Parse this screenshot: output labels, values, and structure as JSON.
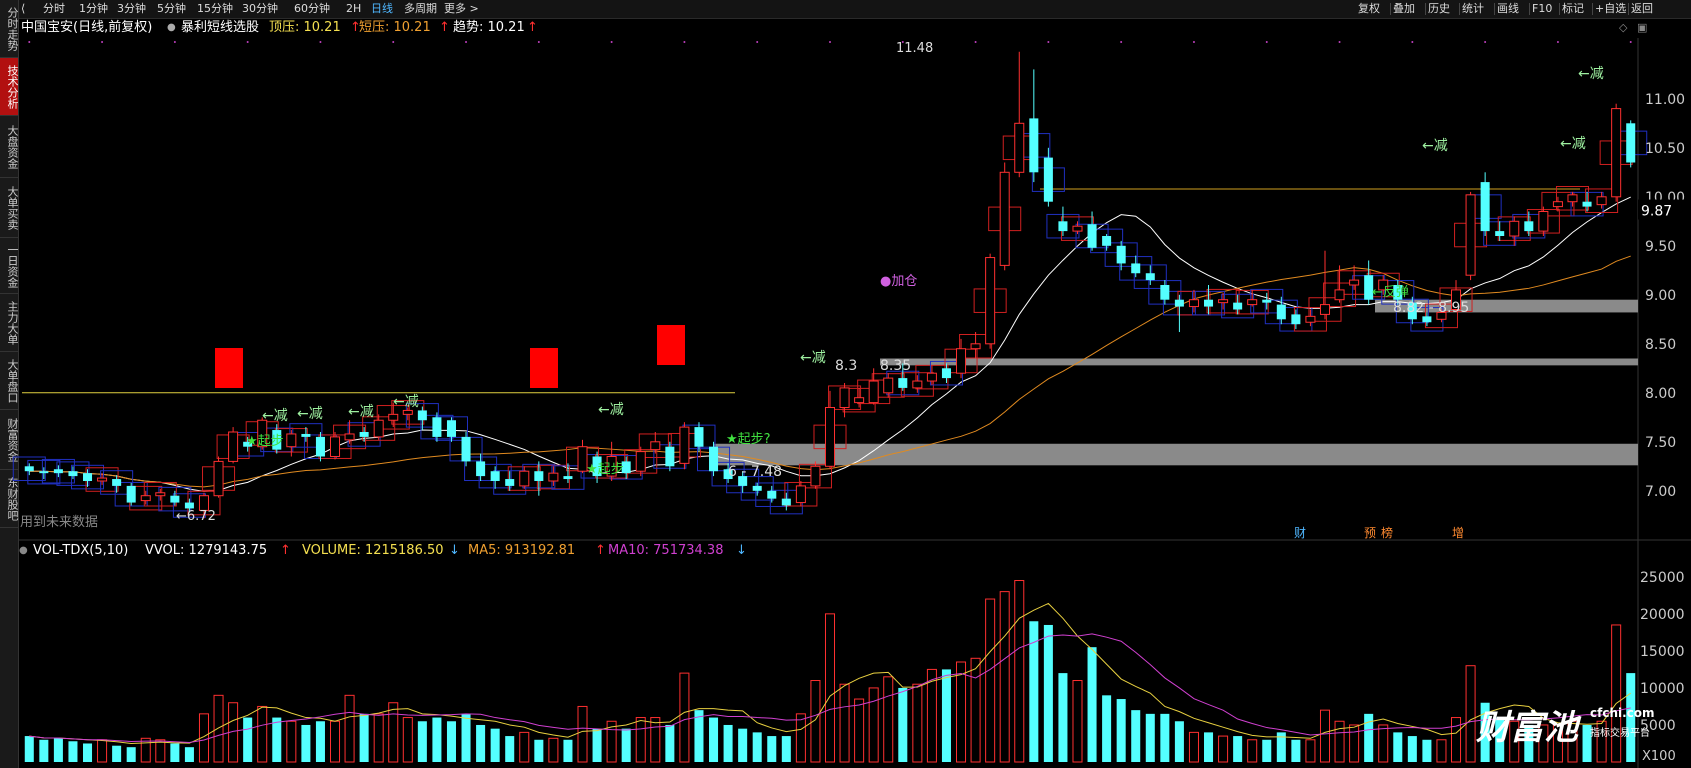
{
  "sidebar": {
    "tabs": [
      {
        "label": "分时走势",
        "active": false
      },
      {
        "label": "技术分析",
        "active": true
      },
      {
        "label": "大盘资金",
        "active": false
      },
      {
        "label": "大单买卖",
        "active": false
      },
      {
        "label": "一日资金",
        "active": false
      },
      {
        "label": "主力大单",
        "active": false
      },
      {
        "label": "大单盘口",
        "active": false
      },
      {
        "label": "财富资金",
        "active": false
      },
      {
        "label": "东财股吧",
        "active": false
      }
    ]
  },
  "toolbar": {
    "back_icon": "back-arrow-icon",
    "periods": [
      {
        "label": "分时",
        "active": false
      },
      {
        "label": "1分钟",
        "active": false
      },
      {
        "label": "3分钟",
        "active": false
      },
      {
        "label": "5分钟",
        "active": false
      },
      {
        "label": "15分钟",
        "active": false
      },
      {
        "label": "30分钟",
        "active": false
      },
      {
        "label": "60分钟",
        "active": false
      },
      {
        "label": "2H",
        "active": false
      },
      {
        "label": "日线",
        "active": true
      },
      {
        "label": "多周期",
        "active": false
      },
      {
        "label": "更多 >",
        "active": false
      }
    ],
    "right": [
      "复权",
      "叠加",
      "历史",
      "统计",
      "画线",
      "F10",
      "标记",
      "+自选",
      "返回"
    ]
  },
  "info": {
    "stock": "中国宝安(日线,前复权)",
    "indicator": "暴利短线选股",
    "top_label": "顶压: 10.21",
    "short_label": "短压: 10.21",
    "trend_label": "趋势: 10.21",
    "arrow": "↑",
    "colors": {
      "top": "#f5e050",
      "short": "#f0a030",
      "trend": "#ffffff",
      "arrow": "#ff3030"
    }
  },
  "price_axis": {
    "labels": [
      "11.00",
      "10.50",
      "10.00",
      "9.50",
      "9.00",
      "8.50",
      "8.00",
      "7.50",
      "7.00"
    ],
    "current": "9.87"
  },
  "annotations": {
    "high": "11.48",
    "low": "6.72",
    "zone1": "6 - 7.48",
    "zone2": "8.35",
    "zone2_prefix": "8.3",
    "zone3": "8.82 - 8.95",
    "future_note": "用到未来数据",
    "reduce": "←减",
    "start": "★起步",
    "start2": "★起步?",
    "add": "●加仓",
    "rebound": "←反弹",
    "markers": [
      "财",
      "预",
      "榜",
      "增"
    ]
  },
  "volume": {
    "indicator": "VOL-TDX(5,10)",
    "vvol": "VVOL: 1279143.75",
    "vol": "VOLUME: 1215186.50",
    "ma5": "MA5: 913192.81",
    "ma10": "MA10: 751734.38",
    "up_arrow": "↑",
    "down_arrow": "↓",
    "axis": [
      "25000",
      "20000",
      "15000",
      "10000",
      "5000"
    ],
    "unit": "X100",
    "colors": {
      "vvol": "#ffffff",
      "vol": "#f5e050",
      "ma5": "#f0a030",
      "ma10": "#d040d0"
    }
  },
  "watermark": {
    "brand": "财富池",
    "domain": "cfchi.com",
    "slogan": "指标交易平台"
  },
  "chart_data": {
    "type": "candlestick",
    "title": "中国宝安(日线,前复权)",
    "y_range": [
      6.6,
      11.6
    ],
    "candles": [
      [
        7.25,
        7.2,
        7.28,
        7.16,
        0
      ],
      [
        7.18,
        7.2,
        7.24,
        7.12,
        0
      ],
      [
        7.22,
        7.18,
        7.26,
        7.14,
        0
      ],
      [
        7.15,
        7.2,
        7.25,
        7.12,
        0
      ],
      [
        7.18,
        7.1,
        7.22,
        7.04,
        0
      ],
      [
        7.1,
        7.13,
        7.18,
        7.06,
        1
      ],
      [
        7.12,
        7.05,
        7.16,
        6.98,
        0
      ],
      [
        7.05,
        6.88,
        7.08,
        6.85,
        0
      ],
      [
        6.9,
        6.95,
        7.0,
        6.86,
        1
      ],
      [
        6.95,
        6.98,
        7.02,
        6.9,
        1
      ],
      [
        6.95,
        6.88,
        7.0,
        6.85,
        0
      ],
      [
        6.88,
        6.82,
        6.92,
        6.78,
        0
      ],
      [
        6.8,
        6.95,
        6.98,
        6.72,
        1
      ],
      [
        6.95,
        7.3,
        7.35,
        6.93,
        1
      ],
      [
        7.3,
        7.6,
        7.65,
        7.28,
        1
      ],
      [
        7.5,
        7.45,
        7.55,
        7.4,
        0
      ],
      [
        7.45,
        7.72,
        7.75,
        7.42,
        1
      ],
      [
        7.62,
        7.42,
        7.68,
        7.38,
        0
      ],
      [
        7.45,
        7.58,
        7.62,
        7.35,
        1
      ],
      [
        7.58,
        7.55,
        7.65,
        7.5,
        0
      ],
      [
        7.55,
        7.35,
        7.6,
        7.3,
        0
      ],
      [
        7.35,
        7.55,
        7.6,
        7.32,
        1
      ],
      [
        7.52,
        7.58,
        7.72,
        7.48,
        1
      ],
      [
        7.6,
        7.55,
        7.65,
        7.5,
        0
      ],
      [
        7.55,
        7.72,
        7.78,
        7.52,
        1
      ],
      [
        7.72,
        7.78,
        7.9,
        7.65,
        1
      ],
      [
        7.78,
        7.82,
        7.85,
        7.72,
        1
      ],
      [
        7.82,
        7.72,
        7.86,
        7.62,
        0
      ],
      [
        7.75,
        7.55,
        7.8,
        7.5,
        0
      ],
      [
        7.72,
        7.55,
        7.75,
        7.5,
        0
      ],
      [
        7.55,
        7.3,
        7.6,
        7.25,
        0
      ],
      [
        7.3,
        7.15,
        7.38,
        7.1,
        0
      ],
      [
        7.2,
        7.1,
        7.25,
        7.02,
        0
      ],
      [
        7.12,
        7.05,
        7.2,
        7.0,
        0
      ],
      [
        7.05,
        7.2,
        7.25,
        7.02,
        1
      ],
      [
        7.2,
        7.1,
        7.3,
        6.95,
        0
      ],
      [
        7.1,
        7.18,
        7.25,
        7.05,
        1
      ],
      [
        7.15,
        7.12,
        7.28,
        7.08,
        0
      ],
      [
        7.2,
        7.45,
        7.52,
        7.18,
        1
      ],
      [
        7.35,
        7.15,
        7.4,
        7.08,
        0
      ],
      [
        7.15,
        7.35,
        7.5,
        7.1,
        1
      ],
      [
        7.3,
        7.18,
        7.35,
        7.12,
        0
      ],
      [
        7.2,
        7.4,
        7.45,
        7.15,
        1
      ],
      [
        7.42,
        7.5,
        7.6,
        7.38,
        1
      ],
      [
        7.45,
        7.25,
        7.5,
        7.2,
        0
      ],
      [
        7.28,
        7.65,
        7.7,
        7.22,
        1
      ],
      [
        7.65,
        7.45,
        7.7,
        7.4,
        0
      ],
      [
        7.45,
        7.2,
        7.5,
        7.15,
        0
      ],
      [
        7.22,
        7.12,
        7.28,
        7.08,
        0
      ],
      [
        7.15,
        7.05,
        7.2,
        6.98,
        0
      ],
      [
        7.05,
        7.0,
        7.08,
        6.95,
        0
      ],
      [
        7.0,
        6.92,
        7.05,
        6.88,
        0
      ],
      [
        6.92,
        6.85,
        6.98,
        6.8,
        0
      ],
      [
        6.88,
        7.05,
        7.1,
        6.84,
        1
      ],
      [
        7.05,
        7.25,
        7.3,
        7.02,
        1
      ],
      [
        7.25,
        7.85,
        8.02,
        7.22,
        1
      ],
      [
        7.85,
        8.05,
        8.1,
        7.75,
        1
      ],
      [
        7.9,
        7.95,
        8.05,
        7.85,
        1
      ],
      [
        7.9,
        8.12,
        8.25,
        7.88,
        1
      ],
      [
        8.0,
        8.15,
        8.2,
        7.95,
        1
      ],
      [
        8.15,
        8.05,
        8.3,
        8.02,
        0
      ],
      [
        8.05,
        8.12,
        8.18,
        8.0,
        1
      ],
      [
        8.12,
        8.2,
        8.28,
        8.08,
        1
      ],
      [
        8.25,
        8.15,
        8.3,
        8.1,
        0
      ],
      [
        8.2,
        8.45,
        8.55,
        8.15,
        1
      ],
      [
        8.45,
        8.5,
        8.62,
        8.35,
        1
      ],
      [
        8.5,
        9.38,
        9.42,
        8.45,
        1
      ],
      [
        9.3,
        10.25,
        10.35,
        9.25,
        1
      ],
      [
        10.25,
        10.75,
        11.48,
        10.2,
        1
      ],
      [
        10.8,
        10.25,
        11.3,
        10.15,
        0
      ],
      [
        10.4,
        9.95,
        10.5,
        9.9,
        0
      ],
      [
        9.75,
        9.65,
        9.9,
        9.6,
        0
      ],
      [
        9.7,
        9.65,
        9.75,
        9.62,
        1
      ],
      [
        9.72,
        9.48,
        9.85,
        9.45,
        0
      ],
      [
        9.6,
        9.5,
        9.62,
        9.45,
        0
      ],
      [
        9.5,
        9.32,
        9.55,
        9.25,
        0
      ],
      [
        9.32,
        9.22,
        9.4,
        9.18,
        0
      ],
      [
        9.22,
        9.15,
        9.3,
        9.1,
        0
      ],
      [
        9.1,
        8.95,
        9.15,
        8.9,
        0
      ],
      [
        8.95,
        8.88,
        9.0,
        8.62,
        0
      ],
      [
        8.88,
        8.95,
        9.05,
        8.82,
        1
      ],
      [
        8.95,
        8.88,
        9.1,
        8.8,
        0
      ],
      [
        8.92,
        8.95,
        9.02,
        8.85,
        1
      ],
      [
        8.92,
        8.85,
        9.0,
        8.8,
        0
      ],
      [
        8.9,
        8.95,
        9.05,
        8.88,
        1
      ],
      [
        8.95,
        8.92,
        9.02,
        8.85,
        0
      ],
      [
        8.9,
        8.75,
        8.98,
        8.7,
        0
      ],
      [
        8.8,
        8.7,
        8.85,
        8.65,
        0
      ],
      [
        8.72,
        8.78,
        8.85,
        8.68,
        1
      ],
      [
        8.8,
        8.9,
        9.45,
        8.75,
        1
      ],
      [
        8.95,
        9.05,
        9.3,
        8.92,
        1
      ],
      [
        9.1,
        9.15,
        9.3,
        9.05,
        1
      ],
      [
        9.2,
        8.95,
        9.35,
        8.9,
        0
      ],
      [
        9.05,
        9.15,
        9.2,
        9.0,
        1
      ],
      [
        9.1,
        8.95,
        9.15,
        8.9,
        0
      ],
      [
        8.92,
        8.75,
        8.98,
        8.7,
        0
      ],
      [
        8.78,
        8.72,
        8.82,
        8.68,
        0
      ],
      [
        8.75,
        8.82,
        8.85,
        8.72,
        1
      ],
      [
        8.85,
        9.05,
        9.15,
        8.82,
        1
      ],
      [
        9.2,
        10.02,
        10.05,
        9.15,
        1
      ],
      [
        10.15,
        9.65,
        10.25,
        9.6,
        0
      ],
      [
        9.65,
        9.6,
        9.75,
        9.55,
        0
      ],
      [
        9.6,
        9.75,
        9.8,
        9.5,
        1
      ],
      [
        9.75,
        9.65,
        9.85,
        9.6,
        0
      ],
      [
        9.65,
        9.85,
        9.9,
        9.6,
        1
      ],
      [
        9.9,
        9.95,
        10.0,
        9.85,
        1
      ],
      [
        9.95,
        10.02,
        10.05,
        9.9,
        1
      ],
      [
        9.95,
        9.9,
        10.05,
        9.85,
        0
      ],
      [
        9.92,
        10.0,
        10.05,
        9.88,
        1
      ],
      [
        10.0,
        10.9,
        10.95,
        9.95,
        1
      ],
      [
        10.75,
        10.35,
        10.78,
        10.3,
        0
      ]
    ],
    "volumes": [
      [
        3.5,
        0
      ],
      [
        3.0,
        0
      ],
      [
        3.2,
        0
      ],
      [
        2.8,
        0
      ],
      [
        2.5,
        0
      ],
      [
        3.0,
        1
      ],
      [
        2.2,
        0
      ],
      [
        2.0,
        0
      ],
      [
        3.2,
        1
      ],
      [
        3.0,
        1
      ],
      [
        2.5,
        0
      ],
      [
        2.0,
        0
      ],
      [
        6.5,
        1
      ],
      [
        9.0,
        1
      ],
      [
        8.0,
        1
      ],
      [
        6.0,
        0
      ],
      [
        7.5,
        1
      ],
      [
        6.0,
        0
      ],
      [
        5.5,
        1
      ],
      [
        5.0,
        0
      ],
      [
        5.5,
        0
      ],
      [
        5.5,
        1
      ],
      [
        9.0,
        1
      ],
      [
        6.5,
        0
      ],
      [
        6.5,
        1
      ],
      [
        8.0,
        1
      ],
      [
        6.0,
        1
      ],
      [
        5.5,
        0
      ],
      [
        6.0,
        0
      ],
      [
        5.5,
        0
      ],
      [
        6.5,
        0
      ],
      [
        5.0,
        0
      ],
      [
        4.5,
        0
      ],
      [
        3.5,
        0
      ],
      [
        4.0,
        1
      ],
      [
        3.0,
        0
      ],
      [
        3.2,
        1
      ],
      [
        3.0,
        0
      ],
      [
        7.5,
        1
      ],
      [
        4.5,
        0
      ],
      [
        5.5,
        1
      ],
      [
        4.5,
        0
      ],
      [
        6.0,
        1
      ],
      [
        6.0,
        1
      ],
      [
        5.0,
        0
      ],
      [
        12.0,
        1
      ],
      [
        7.0,
        0
      ],
      [
        6.0,
        0
      ],
      [
        5.0,
        0
      ],
      [
        4.5,
        0
      ],
      [
        4.0,
        0
      ],
      [
        3.5,
        0
      ],
      [
        3.5,
        0
      ],
      [
        6.5,
        1
      ],
      [
        11.0,
        1
      ],
      [
        20.0,
        1
      ],
      [
        10.5,
        1
      ],
      [
        8.5,
        1
      ],
      [
        10.0,
        1
      ],
      [
        11.5,
        1
      ],
      [
        10.0,
        0
      ],
      [
        10.5,
        1
      ],
      [
        12.5,
        1
      ],
      [
        12.5,
        0
      ],
      [
        13.5,
        1
      ],
      [
        14.0,
        1
      ],
      [
        22.0,
        1
      ],
      [
        23.0,
        1
      ],
      [
        24.5,
        1
      ],
      [
        19.0,
        0
      ],
      [
        18.5,
        0
      ],
      [
        12.0,
        0
      ],
      [
        11.0,
        1
      ],
      [
        15.5,
        0
      ],
      [
        9.0,
        0
      ],
      [
        8.5,
        0
      ],
      [
        7.0,
        0
      ],
      [
        6.5,
        0
      ],
      [
        6.5,
        0
      ],
      [
        5.5,
        0
      ],
      [
        4.0,
        1
      ],
      [
        4.0,
        0
      ],
      [
        3.5,
        1
      ],
      [
        3.5,
        0
      ],
      [
        3.0,
        1
      ],
      [
        3.0,
        0
      ],
      [
        4.0,
        0
      ],
      [
        3.0,
        0
      ],
      [
        3.0,
        1
      ],
      [
        7.0,
        1
      ],
      [
        5.5,
        1
      ],
      [
        5.0,
        1
      ],
      [
        6.5,
        0
      ],
      [
        5.0,
        1
      ],
      [
        4.0,
        0
      ],
      [
        3.5,
        0
      ],
      [
        3.0,
        0
      ],
      [
        3.0,
        1
      ],
      [
        6.0,
        1
      ],
      [
        13.0,
        1
      ],
      [
        8.0,
        0
      ],
      [
        6.0,
        0
      ],
      [
        5.5,
        1
      ],
      [
        5.0,
        0
      ],
      [
        5.0,
        1
      ],
      [
        5.0,
        1
      ],
      [
        5.5,
        1
      ],
      [
        5.0,
        0
      ],
      [
        5.5,
        1
      ],
      [
        18.5,
        1
      ],
      [
        12.0,
        0
      ]
    ]
  }
}
